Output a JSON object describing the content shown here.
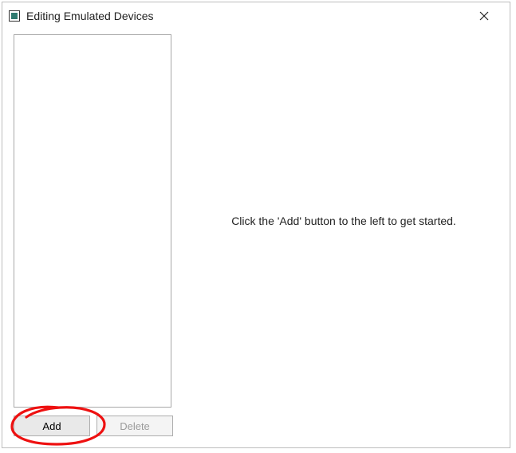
{
  "window": {
    "title": "Editing Emulated Devices"
  },
  "buttons": {
    "add": "Add",
    "delete": "Delete"
  },
  "instructions": {
    "text": "Click the 'Add' button to the left to get started."
  }
}
